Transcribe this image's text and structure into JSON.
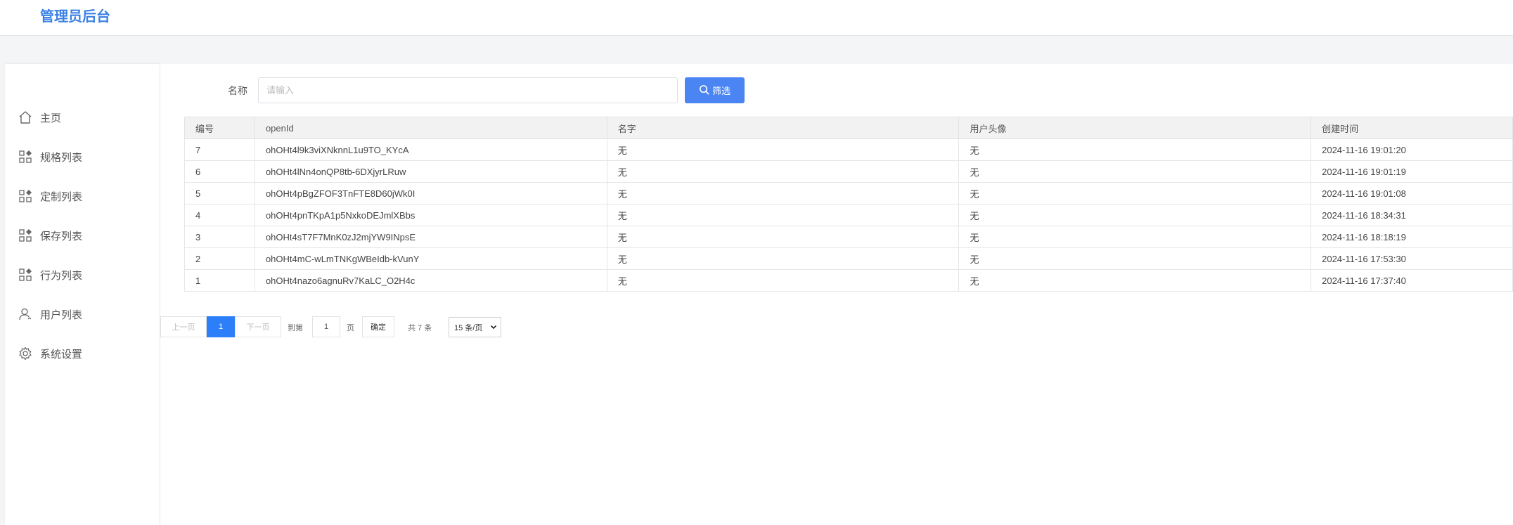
{
  "header": {
    "brand": "管理员后台"
  },
  "sidebar": {
    "items": [
      {
        "label": "主页",
        "icon": "home-icon"
      },
      {
        "label": "规格列表",
        "icon": "grid-icon"
      },
      {
        "label": "定制列表",
        "icon": "grid-icon"
      },
      {
        "label": "保存列表",
        "icon": "grid-icon"
      },
      {
        "label": "行为列表",
        "icon": "grid-icon"
      },
      {
        "label": "用户列表",
        "icon": "user-icon"
      },
      {
        "label": "系统设置",
        "icon": "gear-icon"
      }
    ]
  },
  "filter": {
    "label": "名称",
    "placeholder": "请输入",
    "button_label": "筛选",
    "button_icon": "search-icon",
    "accent_color": "#4a85f3"
  },
  "table": {
    "columns": [
      "编号",
      "openId",
      "名字",
      "用户头像",
      "创建时间"
    ],
    "rows": [
      [
        "7",
        "ohOHt4l9k3viXNknnL1u9TO_KYcA",
        "无",
        "无",
        "2024-11-16 19:01:20"
      ],
      [
        "6",
        "ohOHt4lNn4onQP8tb-6DXjyrLRuw",
        "无",
        "无",
        "2024-11-16 19:01:19"
      ],
      [
        "5",
        "ohOHt4pBgZFOF3TnFTE8D60jWk0I",
        "无",
        "无",
        "2024-11-16 19:01:08"
      ],
      [
        "4",
        "ohOHt4pnTKpA1p5NxkoDEJmlXBbs",
        "无",
        "无",
        "2024-11-16 18:34:31"
      ],
      [
        "3",
        "ohOHt4sT7F7MnK0zJ2mjYW9INpsE",
        "无",
        "无",
        "2024-11-16 18:18:19"
      ],
      [
        "2",
        "ohOHt4mC-wLmTNKgWBeIdb-kVunY",
        "无",
        "无",
        "2024-11-16 17:53:30"
      ],
      [
        "1",
        "ohOHt4nazo6agnuRv7KaLC_O2H4c",
        "无",
        "无",
        "2024-11-16 17:37:40"
      ]
    ]
  },
  "pagination": {
    "prev_label": "上一页",
    "current_page": "1",
    "next_label": "下一页",
    "goto_label": "到第",
    "goto_value": "1",
    "page_unit": "页",
    "confirm_label": "确定",
    "total_label": "共 7 条",
    "page_size_label": "15 条/页",
    "active_color": "#2d7ff9"
  }
}
